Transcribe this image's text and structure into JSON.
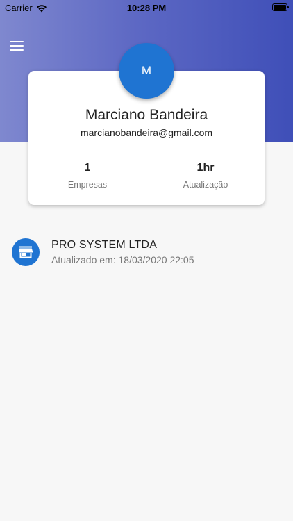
{
  "status_bar": {
    "carrier": "Carrier",
    "time": "10:28 PM",
    "wifi_icon": "wifi-icon",
    "battery_icon": "battery-icon"
  },
  "header": {
    "menu_icon": "hamburger-menu-icon",
    "gradient_start": "#7f88cf",
    "gradient_end": "#3f4fb8"
  },
  "profile": {
    "avatar_initial": "M",
    "name": "Marciano Bandeira",
    "email": "marcianobandeira@gmail.com",
    "avatar_color": "#1f74d2",
    "stats": {
      "companies_value": "1",
      "companies_label": "Empresas",
      "update_value": "1hr",
      "update_label": "Atualização"
    }
  },
  "companies": [
    {
      "name": "PRO SYSTEM LTDA",
      "updated": "Atualizado em: 18/03/2020 22:05",
      "icon": "store-icon"
    }
  ]
}
